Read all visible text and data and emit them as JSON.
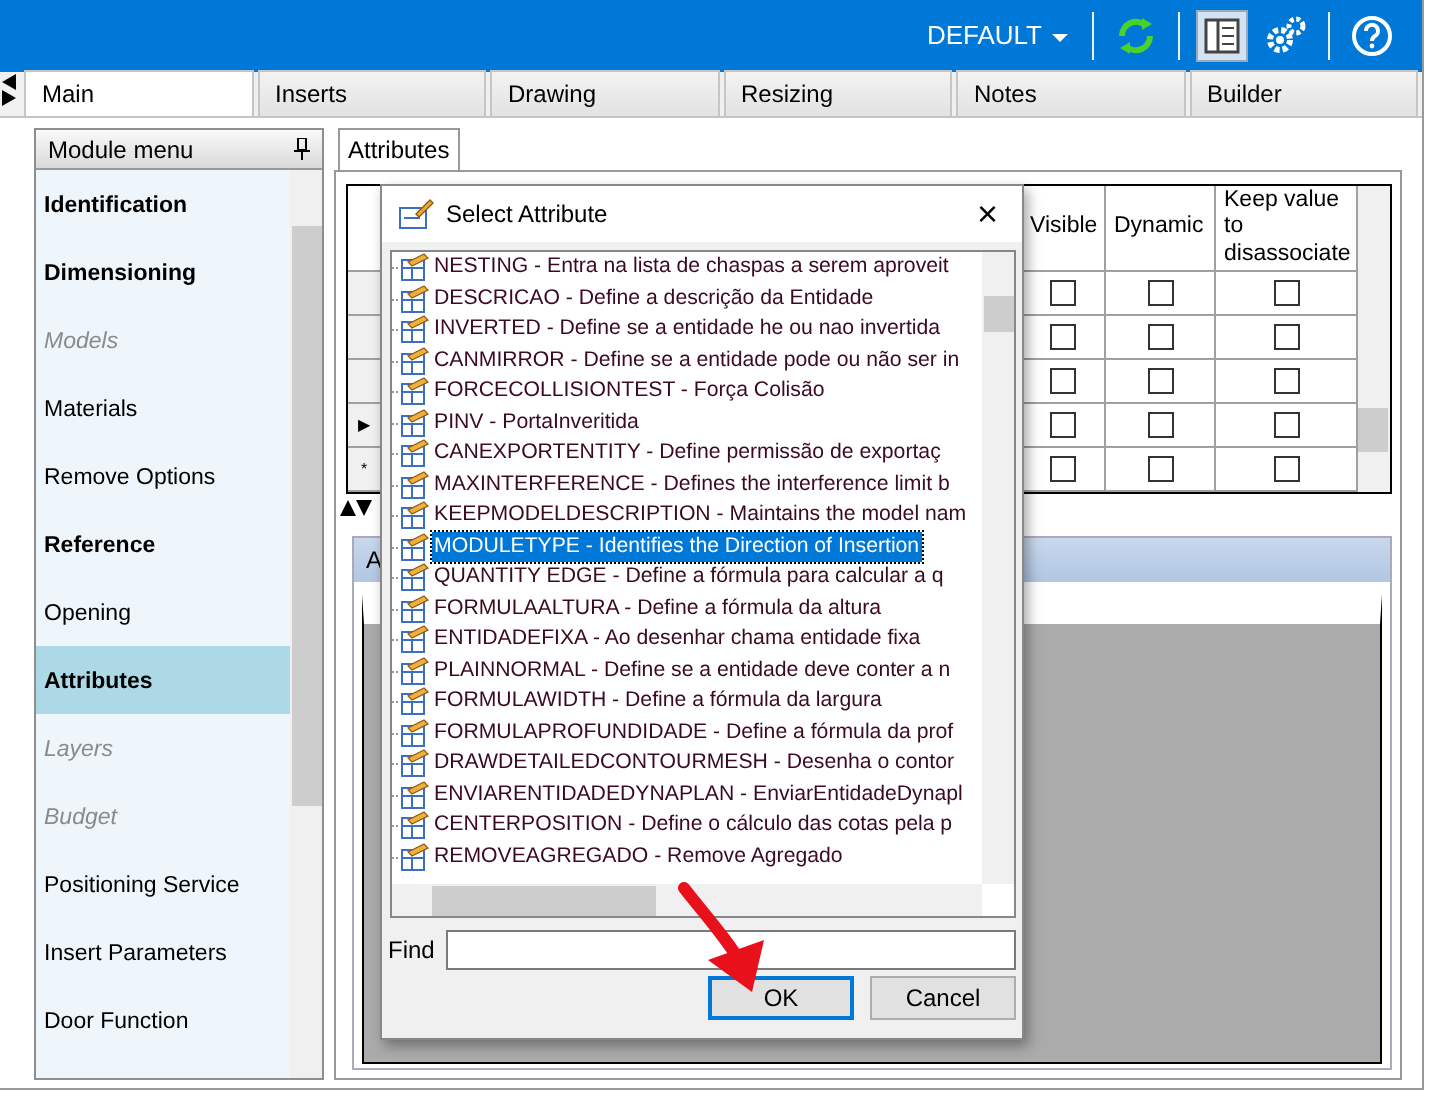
{
  "profile": {
    "label": "DEFAULT"
  },
  "tabs": [
    {
      "label": "Main",
      "selected": true
    },
    {
      "label": "Inserts",
      "selected": false
    },
    {
      "label": "Drawing",
      "selected": false
    },
    {
      "label": "Resizing",
      "selected": false
    },
    {
      "label": "Notes",
      "selected": false
    },
    {
      "label": "Builder",
      "selected": false
    }
  ],
  "module_menu": {
    "title": "Module menu",
    "items": [
      {
        "label": "Identification",
        "kind": "bold",
        "selected": false
      },
      {
        "label": "Dimensioning",
        "kind": "bold",
        "selected": false
      },
      {
        "label": "Models",
        "kind": "disabled",
        "selected": false
      },
      {
        "label": "Materials",
        "kind": "normal",
        "selected": false
      },
      {
        "label": "Remove Options",
        "kind": "normal",
        "selected": false
      },
      {
        "label": "Reference",
        "kind": "bold",
        "selected": false
      },
      {
        "label": "Opening",
        "kind": "normal",
        "selected": false
      },
      {
        "label": "Attributes",
        "kind": "bold",
        "selected": true
      },
      {
        "label": "Layers",
        "kind": "disabled",
        "selected": false
      },
      {
        "label": "Budget",
        "kind": "disabled",
        "selected": false
      },
      {
        "label": "Positioning Service",
        "kind": "normal",
        "selected": false
      },
      {
        "label": "Insert Parameters",
        "kind": "normal",
        "selected": false
      },
      {
        "label": "Door Function",
        "kind": "normal",
        "selected": false
      }
    ]
  },
  "inner_tabs": [
    {
      "label": "Attributes",
      "selected": true
    }
  ],
  "grid": {
    "columns": [
      "Visible",
      "Dynamic",
      "Keep value to disassociate"
    ],
    "rows": [
      {
        "visible": false,
        "dynamic": false,
        "keep_value": false
      },
      {
        "visible": false,
        "dynamic": false,
        "keep_value": false
      },
      {
        "visible": false,
        "dynamic": false,
        "keep_value": false
      },
      {
        "marker": "▶",
        "visible": false,
        "dynamic": false,
        "keep_value": false
      },
      {
        "marker": "*",
        "visible": false,
        "dynamic": false,
        "keep_value": false
      }
    ]
  },
  "lower_panel": {
    "title": "A"
  },
  "dialog": {
    "title": "Select Attribute",
    "close": "×",
    "items": [
      {
        "text": "NESTING - Entra na lista de chaspas a serem aproveit",
        "selected": false
      },
      {
        "text": "DESCRICAO - Define a descrição da Entidade",
        "selected": false
      },
      {
        "text": "INVERTED - Define se a entidade he ou nao invertida",
        "selected": false
      },
      {
        "text": "CANMIRROR - Define se a entidade pode ou não ser in",
        "selected": false
      },
      {
        "text": "FORCECOLLISIONTEST - Força Colisão",
        "selected": false
      },
      {
        "text": "PINV - PortaInveritida",
        "selected": false
      },
      {
        "text": "CANEXPORTENTITY - Define permissão de exportaç",
        "selected": false
      },
      {
        "text": "MAXINTERFERENCE - Defines the interference limit b",
        "selected": false
      },
      {
        "text": "KEEPMODELDESCRIPTION - Maintains the model nam",
        "selected": false
      },
      {
        "text": "MODULETYPE - Identifies the Direction of Insertion",
        "selected": true
      },
      {
        "text": "QUANTITY EDGE - Define a fórmula para calcular a q",
        "selected": false
      },
      {
        "text": "FORMULAALTURA - Define a fórmula da altura",
        "selected": false
      },
      {
        "text": "ENTIDADEFIXA - Ao desenhar chama entidade fixa",
        "selected": false
      },
      {
        "text": "PLAINNORMAL - Define se a entidade deve conter a n",
        "selected": false
      },
      {
        "text": "FORMULAWIDTH - Define a fórmula da largura",
        "selected": false
      },
      {
        "text": "FORMULAPROFUNDIDADE - Define a fórmula da prof",
        "selected": false
      },
      {
        "text": "DRAWDETAILEDCONTOURMESH - Desenha o contor",
        "selected": false
      },
      {
        "text": "ENVIARENTIDADEDYNAPLAN - EnviarEntidadeDynapl",
        "selected": false
      },
      {
        "text": "CENTERPOSITION - Define o cálculo das cotas pela p",
        "selected": false
      },
      {
        "text": "REMOVEAGREGADO - Remove Agregado",
        "selected": false
      }
    ],
    "find": {
      "label": "Find"
    },
    "buttons": [
      {
        "label": "OK",
        "default": true
      },
      {
        "label": "Cancel",
        "default": false
      }
    ]
  }
}
